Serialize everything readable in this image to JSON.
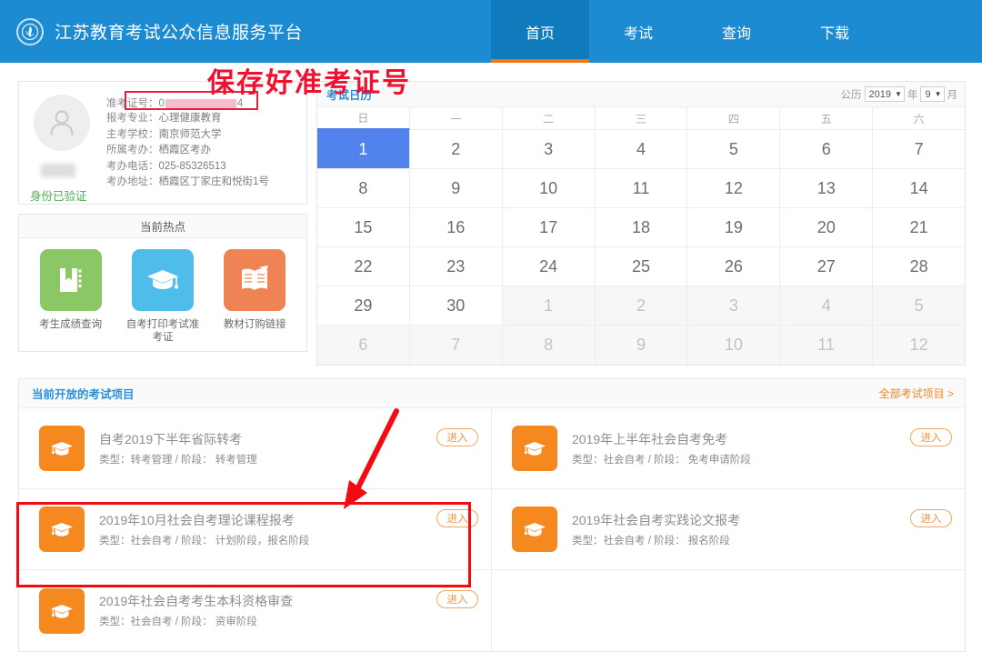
{
  "header": {
    "brand_title": "江苏教育考试公众信息服务平台",
    "logo_icon": "institution-seal-icon",
    "nav": [
      {
        "label": "首页",
        "active": true
      },
      {
        "label": "考试",
        "active": false
      },
      {
        "label": "查询",
        "active": false
      },
      {
        "label": "下载",
        "active": false
      }
    ]
  },
  "user_card": {
    "avatar_icon": "person-avatar-icon",
    "name_redacted": true,
    "verified_label": "身份已验证",
    "ticket_label": "准考证号：",
    "ticket_prefix": "0",
    "ticket_suffix": "4",
    "fields": [
      {
        "label": "报考专业：",
        "value": "心理健康教育"
      },
      {
        "label": "主考学校：",
        "value": "南京师范大学"
      },
      {
        "label": "所属考办：",
        "value": "栖霞区考办"
      },
      {
        "label": "考办电话：",
        "value": "025-85326513"
      },
      {
        "label": "考办地址：",
        "value": "栖霞区丁家庄和悦街1号"
      }
    ]
  },
  "hot_topics": {
    "title": "当前热点",
    "items": [
      {
        "label": "考生成绩查询",
        "icon": "book-icon",
        "color": "#8cc765"
      },
      {
        "label": "自考打印考试准考证",
        "icon": "graduation-cap-icon",
        "color": "#4ebdea"
      },
      {
        "label": "教材订购链接",
        "icon": "open-book-icon",
        "color": "#f08353"
      }
    ]
  },
  "calendar": {
    "title": "考试日历",
    "calendar_type_label": "公历",
    "year_value": "2019",
    "year_unit": "年",
    "month_value": "9",
    "month_unit": "月",
    "weekdays": [
      "日",
      "一",
      "二",
      "三",
      "四",
      "五",
      "六"
    ],
    "weeks": [
      [
        {
          "d": "1",
          "today": true
        },
        {
          "d": "2"
        },
        {
          "d": "3"
        },
        {
          "d": "4"
        },
        {
          "d": "5"
        },
        {
          "d": "6"
        },
        {
          "d": "7"
        }
      ],
      [
        {
          "d": "8"
        },
        {
          "d": "9"
        },
        {
          "d": "10"
        },
        {
          "d": "11"
        },
        {
          "d": "12"
        },
        {
          "d": "13"
        },
        {
          "d": "14"
        }
      ],
      [
        {
          "d": "15"
        },
        {
          "d": "16"
        },
        {
          "d": "17"
        },
        {
          "d": "18"
        },
        {
          "d": "19"
        },
        {
          "d": "20"
        },
        {
          "d": "21"
        }
      ],
      [
        {
          "d": "22"
        },
        {
          "d": "23"
        },
        {
          "d": "24"
        },
        {
          "d": "25"
        },
        {
          "d": "26"
        },
        {
          "d": "27"
        },
        {
          "d": "28"
        }
      ],
      [
        {
          "d": "29"
        },
        {
          "d": "30"
        },
        {
          "d": "1",
          "other": true
        },
        {
          "d": "2",
          "other": true
        },
        {
          "d": "3",
          "other": true
        },
        {
          "d": "4",
          "other": true
        },
        {
          "d": "5",
          "other": true
        }
      ],
      [
        {
          "d": "6",
          "other": true
        },
        {
          "d": "7",
          "other": true
        },
        {
          "d": "8",
          "other": true
        },
        {
          "d": "9",
          "other": true
        },
        {
          "d": "10",
          "other": true
        },
        {
          "d": "11",
          "other": true
        },
        {
          "d": "12",
          "other": true
        }
      ]
    ]
  },
  "projects": {
    "title": "当前开放的考试项目",
    "more_label": "全部考试项目 >",
    "enter_label": "进入",
    "items": [
      {
        "name": "自考2019下半年省际转考",
        "meta": "类型：转考管理 / 阶段： 转考管理",
        "highlighted": false
      },
      {
        "name": "2019年上半年社会自考免考",
        "meta": "类型：社会自考 / 阶段： 免考申请阶段",
        "highlighted": false
      },
      {
        "name": "2019年10月社会自考理论课程报考",
        "meta": "类型：社会自考 / 阶段： 计划阶段，报名阶段",
        "highlighted": true
      },
      {
        "name": "2019年社会自考实践论文报考",
        "meta": "类型：社会自考 / 阶段： 报名阶段",
        "highlighted": false
      },
      {
        "name": "2019年社会自考考生本科资格审查",
        "meta": "类型：社会自考 / 阶段： 资审阶段",
        "highlighted": false
      }
    ]
  },
  "annotations": {
    "note_text": "保存好准考证号",
    "note_color": "#f01030",
    "arrow_color": "#f40b12",
    "box_color": "#f40b12"
  }
}
